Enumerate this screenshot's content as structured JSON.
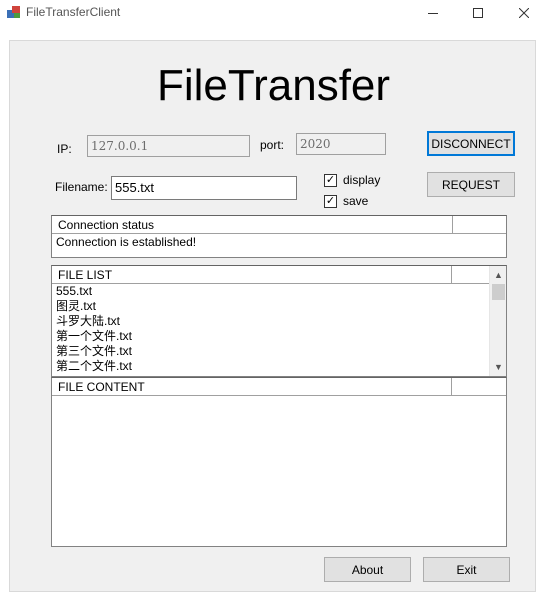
{
  "window": {
    "title": "FileTransferClient",
    "min_glyph": "—",
    "max_glyph": "☐",
    "close_glyph": "✕"
  },
  "header": {
    "title": "FileTransfer"
  },
  "connection_form": {
    "ip_label": "IP:",
    "ip_value": "127.0.0.1",
    "port_label": "port:",
    "port_value": "2020",
    "disconnect_label": "DISCONNECT",
    "filename_label": "Filename:",
    "filename_value": "555.txt",
    "request_label": "REQUEST",
    "display_label": "display",
    "display_checked": true,
    "save_label": "save",
    "save_checked": true
  },
  "status_panel": {
    "header": "Connection status",
    "rows": [
      "Connection is established!"
    ]
  },
  "file_list": {
    "header": "FILE LIST",
    "rows": [
      "555.txt",
      "图灵.txt",
      "斗罗大陆.txt",
      "第一个文件.txt",
      "第三个文件.txt",
      "第二个文件.txt"
    ]
  },
  "file_content": {
    "header": "FILE CONTENT",
    "rows": []
  },
  "footer": {
    "about_label": "About",
    "exit_label": "Exit"
  },
  "icons": {
    "check": "✓",
    "scroll_up": "▲",
    "scroll_down": "▼"
  },
  "colors": {
    "default_button_border": "#0078d7",
    "panel_bg": "#f0f0f0"
  }
}
